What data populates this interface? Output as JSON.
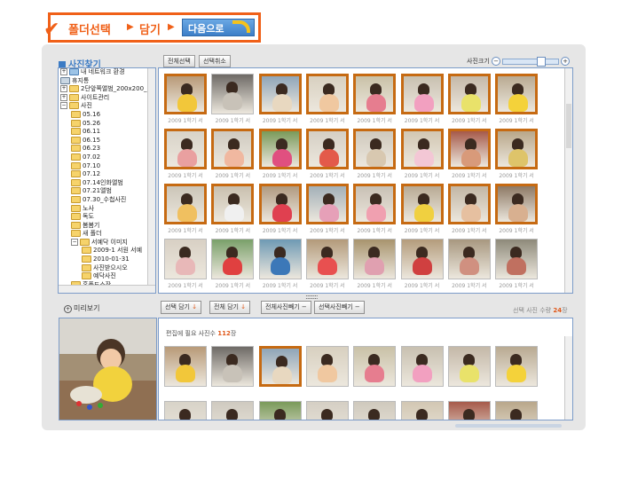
{
  "stepbar": {
    "step1": "폴더선택",
    "step2": "담기",
    "arrow": "▶",
    "next_label": "다음으로"
  },
  "tree": {
    "title": "사진찾기",
    "items": [
      {
        "label": "내 네트워크 환경",
        "depth": 0,
        "pm": "+",
        "kind": "network"
      },
      {
        "label": "휴지통",
        "depth": 0,
        "pm": "",
        "kind": "trash"
      },
      {
        "label": "2단앞쪽앨범_200x200_0",
        "depth": 0,
        "pm": "+",
        "kind": "folder"
      },
      {
        "label": "사이트관리",
        "depth": 0,
        "pm": "+",
        "kind": "folder"
      },
      {
        "label": "사진",
        "depth": 0,
        "pm": "−",
        "kind": "folder"
      },
      {
        "label": "05.16",
        "depth": 1,
        "pm": "",
        "kind": "folder"
      },
      {
        "label": "05.26",
        "depth": 1,
        "pm": "",
        "kind": "folder"
      },
      {
        "label": "06.11",
        "depth": 1,
        "pm": "",
        "kind": "folder"
      },
      {
        "label": "06.15",
        "depth": 1,
        "pm": "",
        "kind": "folder"
      },
      {
        "label": "06.23",
        "depth": 1,
        "pm": "",
        "kind": "folder"
      },
      {
        "label": "07.02",
        "depth": 1,
        "pm": "",
        "kind": "folder"
      },
      {
        "label": "07.10",
        "depth": 1,
        "pm": "",
        "kind": "folder"
      },
      {
        "label": "07.12",
        "depth": 1,
        "pm": "",
        "kind": "folder"
      },
      {
        "label": "07.14인화앨범",
        "depth": 1,
        "pm": "",
        "kind": "folder"
      },
      {
        "label": "07.21앨범",
        "depth": 1,
        "pm": "",
        "kind": "folder"
      },
      {
        "label": "07.30_수첩사진",
        "depth": 1,
        "pm": "",
        "kind": "folder"
      },
      {
        "label": "노사",
        "depth": 1,
        "pm": "",
        "kind": "folder"
      },
      {
        "label": "독도",
        "depth": 1,
        "pm": "",
        "kind": "folder"
      },
      {
        "label": "봄봄기",
        "depth": 1,
        "pm": "",
        "kind": "folder"
      },
      {
        "label": "새 폴더",
        "depth": 1,
        "pm": "",
        "kind": "folder"
      },
      {
        "label": "서예닥 이미지",
        "depth": 1,
        "pm": "−",
        "kind": "folder"
      },
      {
        "label": "2009-1 서원 서예",
        "depth": 2,
        "pm": "",
        "kind": "folder"
      },
      {
        "label": "2010-01-31",
        "depth": 2,
        "pm": "",
        "kind": "folder"
      },
      {
        "label": "사진받으시오",
        "depth": 2,
        "pm": "",
        "kind": "folder"
      },
      {
        "label": "예닥사진",
        "depth": 2,
        "pm": "",
        "kind": "folder"
      },
      {
        "label": "홈폴드소장",
        "depth": 1,
        "pm": "",
        "kind": "folder"
      }
    ]
  },
  "toolbar": {
    "select_all": "전체선택",
    "deselect": "선택취소",
    "zoom_label": "사진크기",
    "zoom_minus": "−",
    "zoom_plus": "+"
  },
  "grid": {
    "caption": "2009 1학기 서",
    "rows": [
      [
        {
          "sel": true,
          "bg": "#b89a78",
          "kid": "#f2c73a"
        },
        {
          "sel": false,
          "bg": "#6e6a66",
          "kid": "#c8c2b8"
        },
        {
          "sel": true,
          "bg": "#8fa5b8",
          "kid": "#e8d8c0"
        },
        {
          "sel": true,
          "bg": "#d8d0c0",
          "kid": "#f0c8a0"
        },
        {
          "sel": true,
          "bg": "#c9c1a7",
          "kid": "#e67d8f"
        },
        {
          "sel": true,
          "bg": "#c8c0b0",
          "kid": "#f2a0c0"
        },
        {
          "sel": true,
          "bg": "#c4b8a8",
          "kid": "#e9e26a"
        },
        {
          "sel": true,
          "bg": "#b9aa92",
          "kid": "#f4d23a"
        }
      ],
      [
        {
          "sel": true,
          "bg": "#d8d3c8",
          "kid": "#e9a0a0"
        },
        {
          "sel": true,
          "bg": "#cfcac0",
          "kid": "#f0b8a0"
        },
        {
          "sel": true,
          "bg": "#7a9a5a",
          "kid": "#e05080"
        },
        {
          "sel": true,
          "bg": "#d5cfc4",
          "kid": "#e35a4a"
        },
        {
          "sel": true,
          "bg": "#cfc9bd",
          "kid": "#d8c8b0"
        },
        {
          "sel": true,
          "bg": "#d2c7b3",
          "kid": "#f3c7d5"
        },
        {
          "sel": true,
          "bg": "#a65a4a",
          "kid": "#d89a7a"
        },
        {
          "sel": true,
          "bg": "#b9a78a",
          "kid": "#dec46a"
        }
      ],
      [
        {
          "sel": true,
          "bg": "#cbc5b8",
          "kid": "#f0c060"
        },
        {
          "sel": true,
          "bg": "#c9bfae",
          "kid": "#f0f0f0"
        },
        {
          "sel": true,
          "bg": "#b09a80",
          "kid": "#e04050"
        },
        {
          "sel": true,
          "bg": "#a3b0b8",
          "kid": "#e6a0b8"
        },
        {
          "sel": true,
          "bg": "#c8c0b4",
          "kid": "#f0a0b0"
        },
        {
          "sel": true,
          "bg": "#b8aa94",
          "kid": "#f0d040"
        },
        {
          "sel": true,
          "bg": "#c2b6a4",
          "kid": "#e6c0a0"
        },
        {
          "sel": true,
          "bg": "#8e7a66",
          "kid": "#d8b090"
        }
      ],
      [
        {
          "sel": false,
          "bg": "#d8d0c4",
          "kid": "#e8b8b8"
        },
        {
          "sel": false,
          "bg": "#7aa06a",
          "kid": "#e04040"
        },
        {
          "sel": false,
          "bg": "#6f9ab4",
          "kid": "#3c78b8"
        },
        {
          "sel": false,
          "bg": "#b39a7a",
          "kid": "#e85050"
        },
        {
          "sel": false,
          "bg": "#a8946e",
          "kid": "#e0a0b0"
        },
        {
          "sel": false,
          "bg": "#b49c7c",
          "kid": "#d04040"
        },
        {
          "sel": false,
          "bg": "#a89880",
          "kid": "#d09080"
        },
        {
          "sel": false,
          "bg": "#8e8a7a",
          "kid": "#c07060"
        }
      ]
    ]
  },
  "actions": {
    "preview": "미리보기",
    "add_selected": "선택 담기",
    "add_all": "전체 담기",
    "remove_all": "전체사진빼기",
    "remove_selected": "선택사진빼기",
    "down_arrow": "↓",
    "minus": "−",
    "selected_label": "선택 사진 수량",
    "selected_count": "24",
    "selected_unit": "장"
  },
  "lower": {
    "need_label": "편집에 필요 사진수",
    "need_count": "112",
    "need_unit": "장",
    "rows": [
      [
        {
          "sel": false,
          "bg": "#b89a78",
          "kid": "#f2c73a"
        },
        {
          "sel": false,
          "bg": "#6e6a66",
          "kid": "#c8c2b8"
        },
        {
          "sel": true,
          "bg": "#8fa5b8",
          "kid": "#e8d8c0"
        },
        {
          "sel": false,
          "bg": "#d8d0c0",
          "kid": "#f0c8a0"
        },
        {
          "sel": false,
          "bg": "#c9c1a7",
          "kid": "#e67d8f"
        },
        {
          "sel": false,
          "bg": "#c8c0b0",
          "kid": "#f2a0c0"
        },
        {
          "sel": false,
          "bg": "#c4b8a8",
          "kid": "#e9e26a"
        },
        {
          "sel": false,
          "bg": "#b9aa92",
          "kid": "#f4d23a"
        }
      ],
      [
        {
          "sel": false,
          "bg": "#d8d3c8",
          "kid": "#e9a0a0"
        },
        {
          "sel": false,
          "bg": "#cfcac0",
          "kid": "#f0b8a0"
        },
        {
          "sel": false,
          "bg": "#7a9a5a",
          "kid": "#e05080"
        },
        {
          "sel": false,
          "bg": "#d5cfc4",
          "kid": "#e35a4a"
        },
        {
          "sel": false,
          "bg": "#cfc9bd",
          "kid": "#d8c8b0"
        },
        {
          "sel": false,
          "bg": "#d2c7b3",
          "kid": "#f3c7d5"
        },
        {
          "sel": false,
          "bg": "#a65a4a",
          "kid": "#d89a7a"
        },
        {
          "sel": false,
          "bg": "#b9a78a",
          "kid": "#dec46a"
        }
      ]
    ]
  },
  "colors": {
    "accent_orange": "#f06018",
    "accent_blue": "#3c7bc4",
    "selected_border": "#c66a12"
  }
}
